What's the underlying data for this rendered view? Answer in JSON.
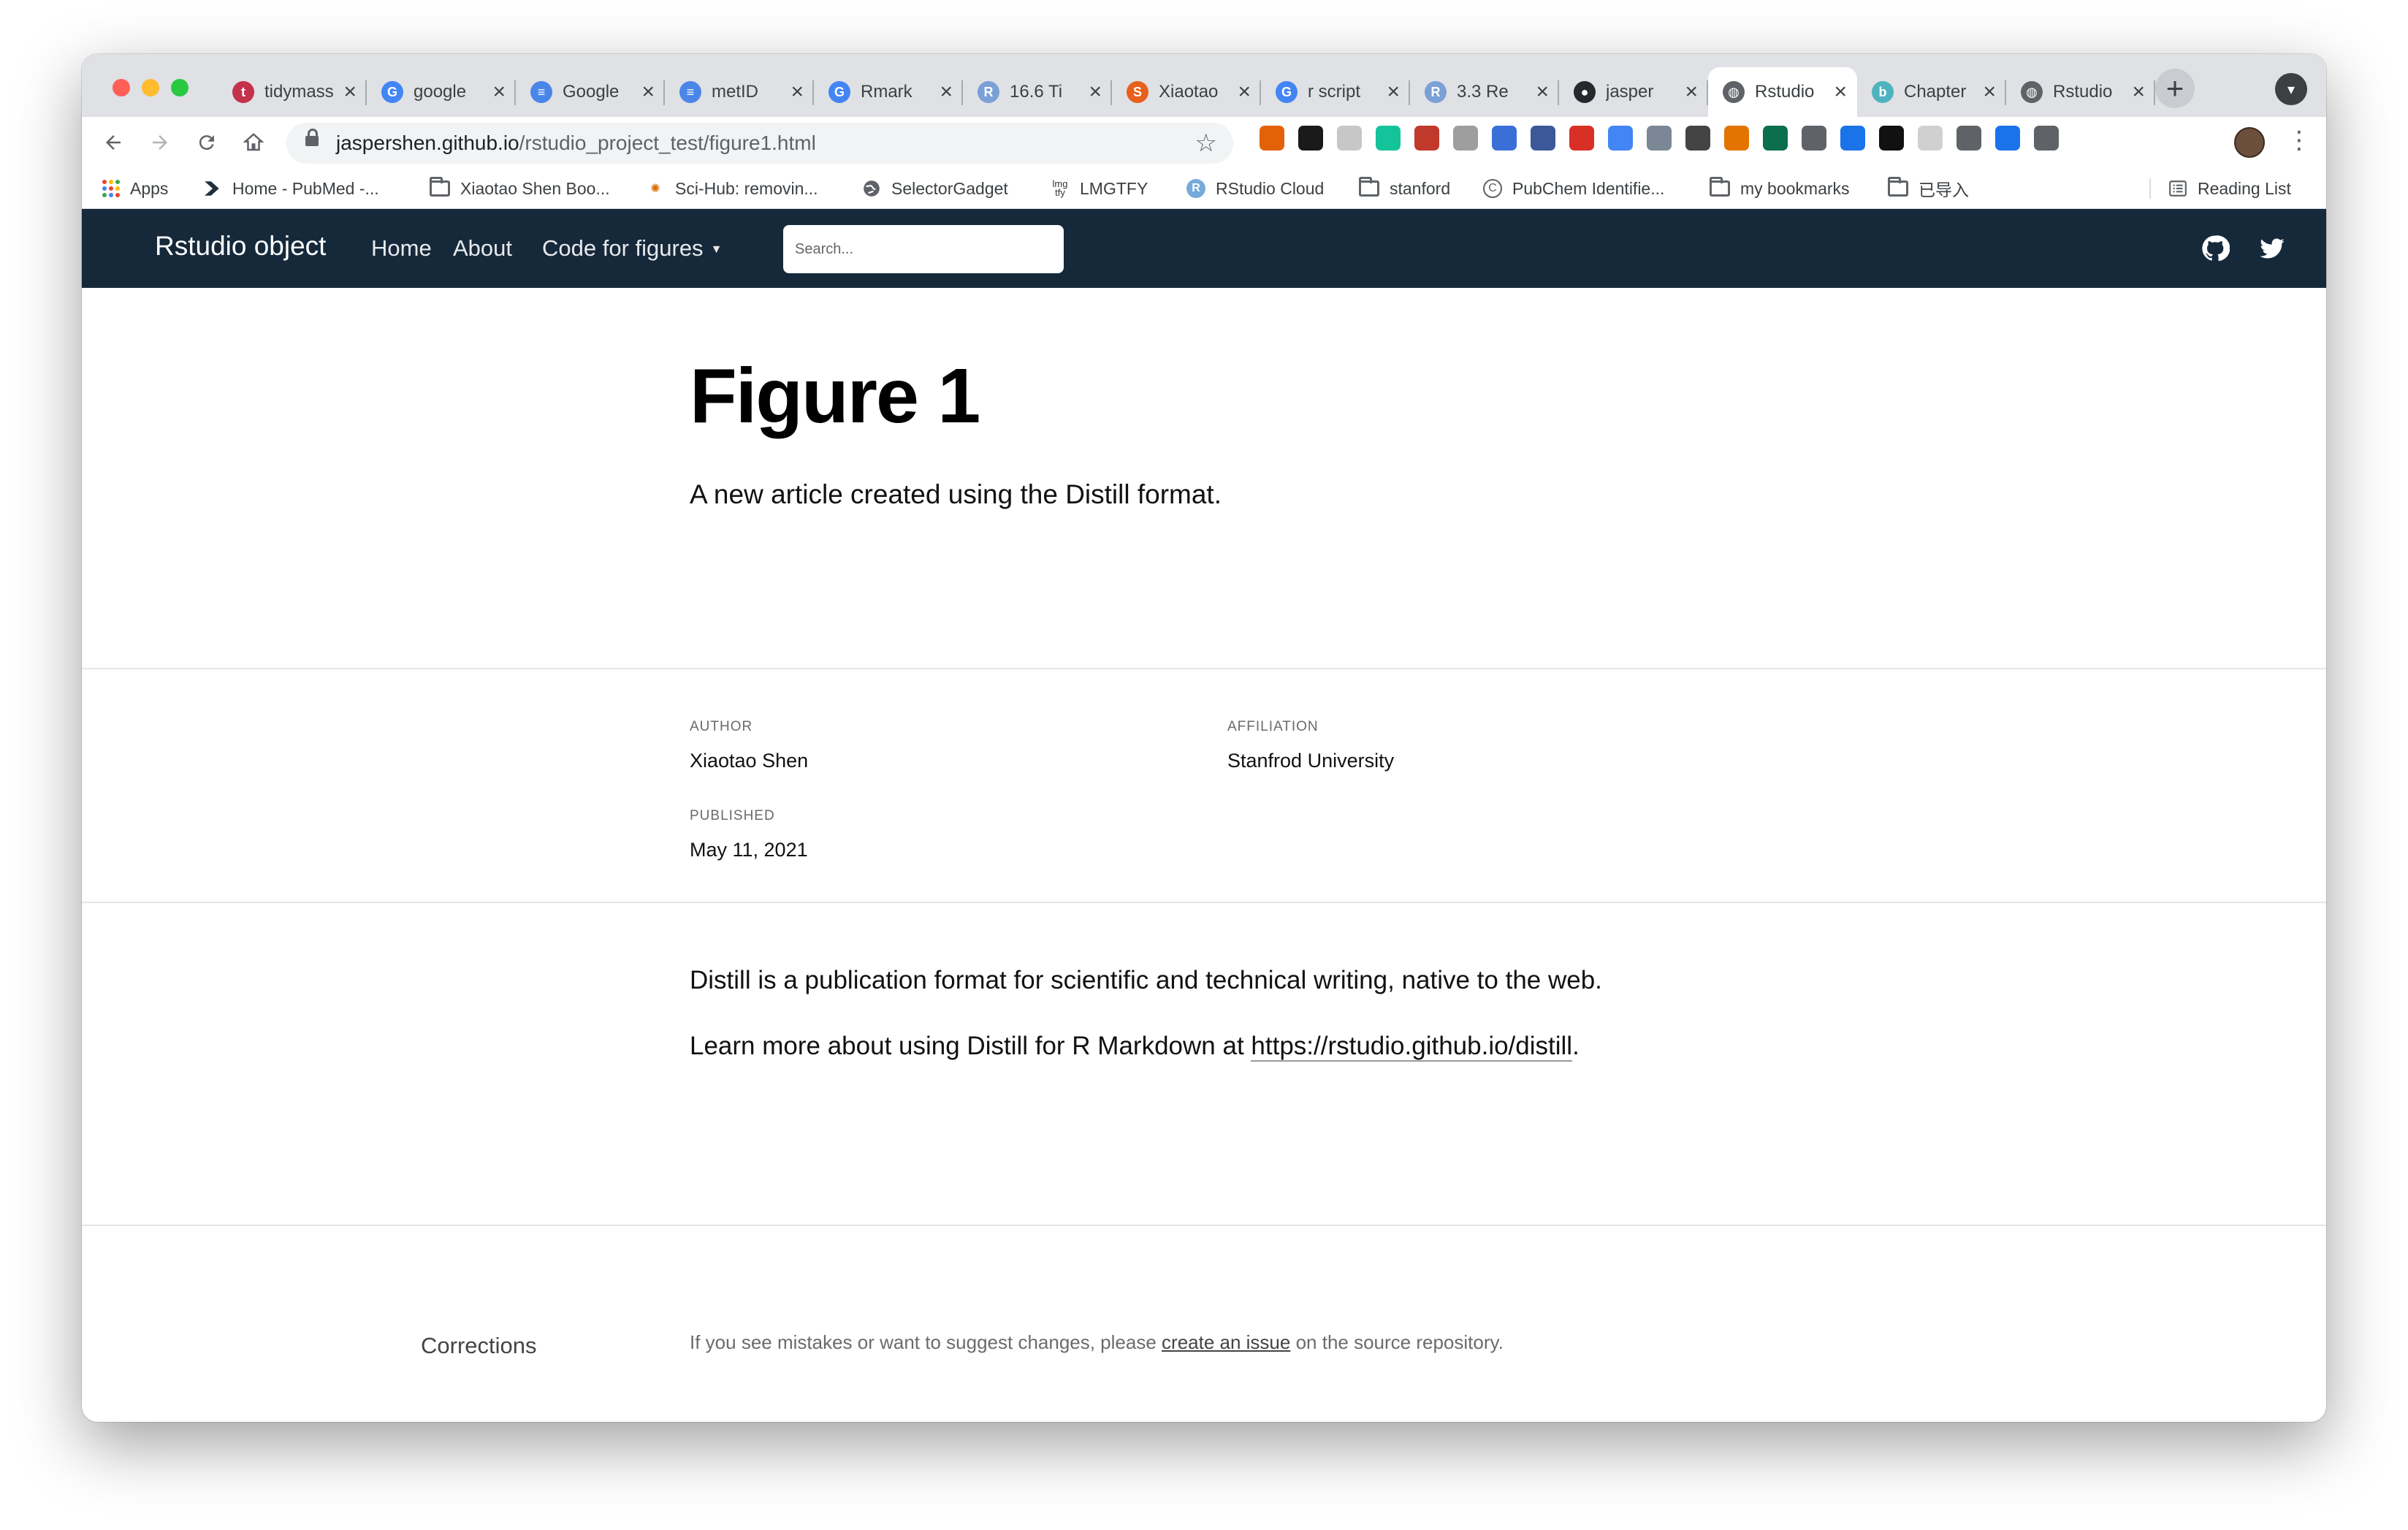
{
  "browser": {
    "tabs": [
      {
        "title": "tidymass",
        "favicon": "tidymass-icon",
        "color": "#c4314b",
        "glyph": "t"
      },
      {
        "title": "google",
        "favicon": "google-icon",
        "color": "#4285f4",
        "glyph": "G"
      },
      {
        "title": "Google",
        "favicon": "google-docs-icon",
        "color": "#4a86e8",
        "glyph": "≡"
      },
      {
        "title": "metID",
        "favicon": "google-docs-icon",
        "color": "#4a86e8",
        "glyph": "≡"
      },
      {
        "title": "Rmark",
        "favicon": "google-icon",
        "color": "#4285f4",
        "glyph": "G"
      },
      {
        "title": "16.6 Ti",
        "favicon": "r-icon",
        "color": "#7aa0d6",
        "glyph": "R"
      },
      {
        "title": "Xiaotao",
        "favicon": "scholar-s-icon",
        "color": "#e8601c",
        "glyph": "S"
      },
      {
        "title": "r script",
        "favicon": "google-icon",
        "color": "#4285f4",
        "glyph": "G"
      },
      {
        "title": "3.3 Re",
        "favicon": "r-icon",
        "color": "#7aa0d6",
        "glyph": "R"
      },
      {
        "title": "jasper",
        "favicon": "github-icon",
        "color": "#24292e",
        "glyph": "●"
      },
      {
        "title": "Rstudio",
        "favicon": "globe-icon",
        "color": "#5f6368",
        "glyph": "◍",
        "active": true
      },
      {
        "title": "Chapter",
        "favicon": "bookdown-icon",
        "color": "#4fb3bf",
        "glyph": "b"
      },
      {
        "title": "Rstudio",
        "favicon": "globe-icon",
        "color": "#5f6368",
        "glyph": "◍"
      }
    ],
    "url_host": "jaspershen.github.io",
    "url_path": "/rstudio_project_test/figure1.html",
    "bookmarks": [
      {
        "label": "Apps",
        "icon": "apps-icon"
      },
      {
        "label": "Home - PubMed -...",
        "icon": "pubmed-icon"
      },
      {
        "label": "Xiaotao Shen Boo...",
        "icon": "folder-icon"
      },
      {
        "label": "Sci-Hub: removin...",
        "icon": "scihub-icon"
      },
      {
        "label": "SelectorGadget",
        "icon": "globe-icon"
      },
      {
        "label": "LMGTFY",
        "icon": "lmgtfy-icon"
      },
      {
        "label": "RStudio Cloud",
        "icon": "r-icon"
      },
      {
        "label": "stanford",
        "icon": "folder-icon"
      },
      {
        "label": "PubChem Identifie...",
        "icon": "pubchem-icon"
      },
      {
        "label": "my bookmarks",
        "icon": "folder-icon"
      },
      {
        "label": "已导入",
        "icon": "folder-icon"
      }
    ],
    "reading_list": "Reading List",
    "extensions": [
      {
        "icon": "zotero-icon",
        "color": "#e36209"
      },
      {
        "icon": "dark-reader-icon",
        "color": "#1a1a1a"
      },
      {
        "icon": "bookmark-icon",
        "color": "#c7c7c7"
      },
      {
        "icon": "grammarly-icon",
        "color": "#15c39a"
      },
      {
        "icon": "book-icon",
        "color": "#c0392b"
      },
      {
        "icon": "cube-icon",
        "color": "#9e9e9e"
      },
      {
        "icon": "cap-icon",
        "color": "#3a6fd8"
      },
      {
        "icon": "person-icon",
        "color": "#3b5998"
      },
      {
        "icon": "grid-icon",
        "color": "#d93025"
      },
      {
        "icon": "translate-icon",
        "color": "#4285f4"
      },
      {
        "icon": "satellite-icon",
        "color": "#7b8794"
      },
      {
        "icon": "shield-icon",
        "color": "#444444"
      },
      {
        "icon": "notion-icon",
        "color": "#e37400"
      },
      {
        "icon": "chart-icon",
        "color": "#0b6e4f"
      },
      {
        "icon": "refresh-icon",
        "color": "#5f6368"
      },
      {
        "icon": "drop-icon",
        "color": "#1a73e8"
      },
      {
        "icon": "swirl-icon",
        "color": "#111111"
      },
      {
        "icon": "loader-icon",
        "color": "#d0d0d0"
      },
      {
        "icon": "square-icon",
        "color": "#5f6368"
      },
      {
        "icon": "pen-icon",
        "color": "#1a73e8"
      },
      {
        "icon": "puzzle-icon",
        "color": "#5f6368"
      }
    ]
  },
  "site": {
    "brand": "Rstudio object",
    "nav": {
      "home": "Home",
      "about": "About",
      "code": "Code for figures"
    },
    "search_placeholder": "Search...",
    "nav_bg": "#15293b"
  },
  "article": {
    "title": "Figure 1",
    "subtitle": "A new article created using the Distill format.",
    "author_label": "AUTHOR",
    "author": "Xiaotao Shen",
    "affiliation_label": "AFFILIATION",
    "affiliation": "Stanfrod University",
    "published_label": "PUBLISHED",
    "published": "May 11, 2021",
    "p1": "Distill is a publication format for scientific and technical writing, native to the web.",
    "p2_before": "Learn more about using Distill for R Markdown at ",
    "p2_link": "https://rstudio.github.io/distill",
    "p2_after": "."
  },
  "corrections": {
    "title": "Corrections",
    "text_before": "If you see mistakes or want to suggest changes, please ",
    "link": "create an issue",
    "text_after": " on the source repository."
  }
}
